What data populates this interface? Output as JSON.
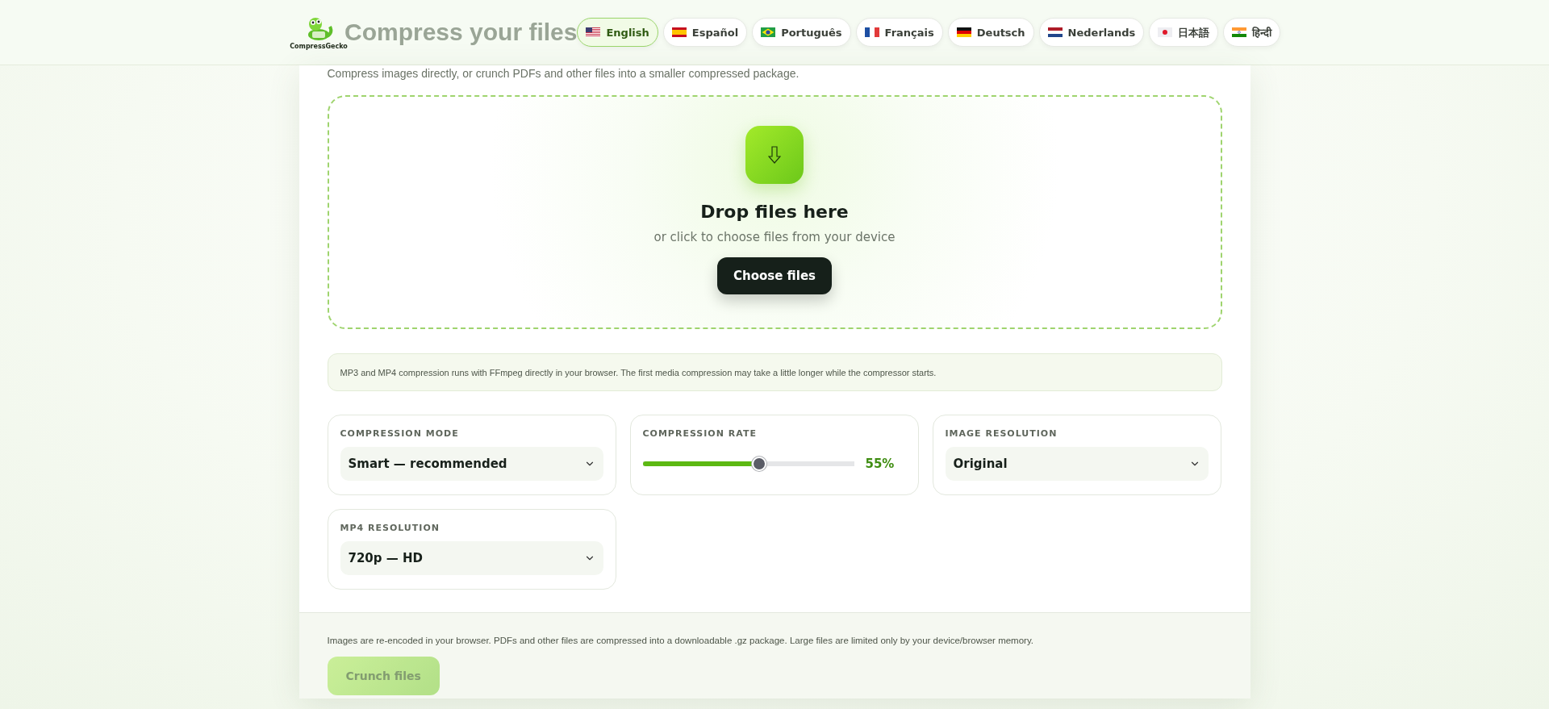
{
  "header": {
    "logo_text": "CompressGecko",
    "title": "Compress your files",
    "languages": [
      {
        "label": "English",
        "kind": "us",
        "selected": true
      },
      {
        "label": "Español",
        "kind": "es",
        "selected": false
      },
      {
        "label": "Português",
        "kind": "br",
        "selected": false
      },
      {
        "label": "Français",
        "kind": "fr",
        "selected": false
      },
      {
        "label": "Deutsch",
        "kind": "de",
        "selected": false
      },
      {
        "label": "Nederlands",
        "kind": "nl",
        "selected": false
      },
      {
        "label": "日本語",
        "kind": "jp",
        "selected": false
      },
      {
        "label": "हिन्दी",
        "kind": "in",
        "selected": false
      }
    ]
  },
  "subtitle": "Compress images directly, or crunch PDFs and other files into a smaller compressed package.",
  "dropzone": {
    "title": "Drop files here",
    "hint": "or click to choose files from your device",
    "button": "Choose files"
  },
  "note": "MP3 and MP4 compression runs with FFmpeg directly in your browser. The first media compression may take a little longer while the compressor starts.",
  "settings": [
    {
      "kind": "select",
      "label": "COMPRESSION MODE",
      "value": "Smart — recommended"
    },
    {
      "kind": "slider",
      "label": "COMPRESSION RATE",
      "level": 0.55,
      "reading": "55%"
    },
    {
      "kind": "select",
      "label": "IMAGE RESOLUTION",
      "value": "Original"
    },
    {
      "kind": "select",
      "label": "MP4 RESOLUTION",
      "value": "720p — HD"
    }
  ],
  "footer": {
    "text": "Images are re-encoded in your browser. PDFs and other files are compressed into a downloadable .gz package. Large files are limited only by your device/browser memory.",
    "button": "Crunch files",
    "button_disabled": true
  }
}
